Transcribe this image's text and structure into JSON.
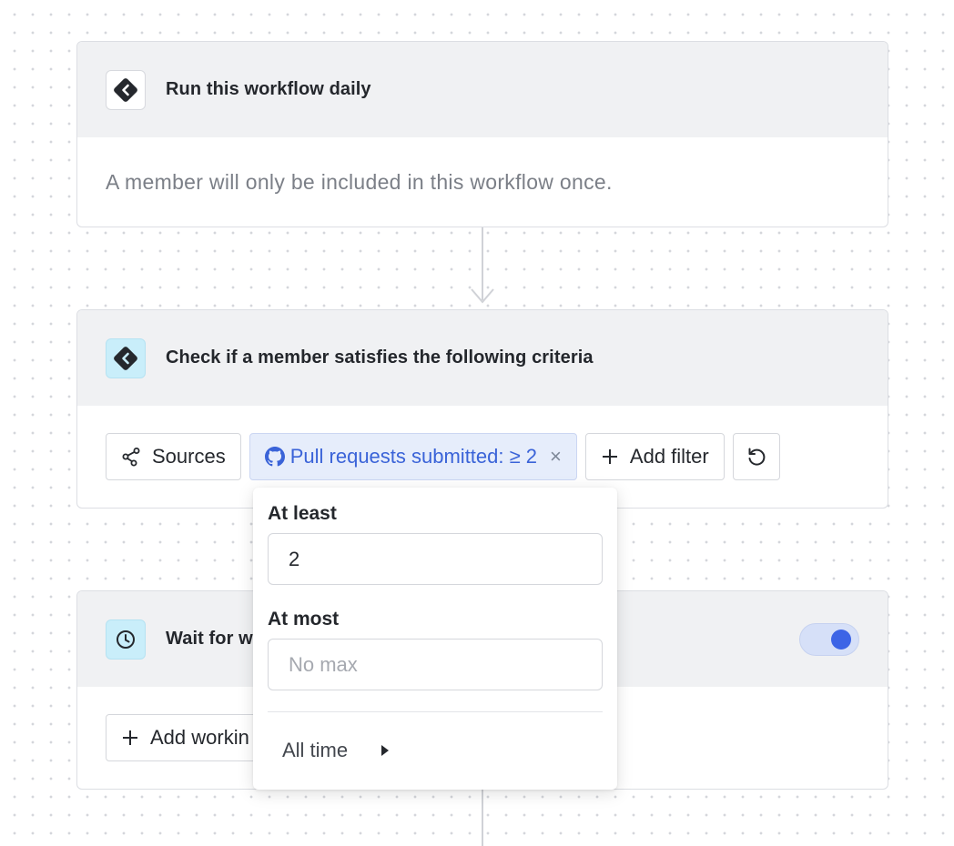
{
  "steps": {
    "trigger": {
      "title": "Run this workflow daily",
      "description": "A member will only be included in this workflow once.",
      "icon": "diamond-chevron-icon"
    },
    "criteria": {
      "title": "Check if a member satisfies the following criteria",
      "icon": "diamond-chevron-icon",
      "sources_label": "Sources",
      "filter_chip_label": "Pull requests submitted: ≥ 2",
      "filter_chip_close": "×",
      "add_filter_label": "Add filter"
    },
    "wait": {
      "title_visible": "Wait for w",
      "icon": "clock-icon",
      "toggle_on": true,
      "add_button_visible": "Add workin"
    }
  },
  "popover": {
    "at_least_label": "At least",
    "at_least_value": "2",
    "at_most_label": "At most",
    "at_most_placeholder": "No max",
    "time_range_label": "All time"
  },
  "colors": {
    "accent": "#3c64e6",
    "chip_bg": "#e6edfb",
    "header_bg": "#f0f1f3",
    "icon_blue_bg": "#c9eefa"
  }
}
